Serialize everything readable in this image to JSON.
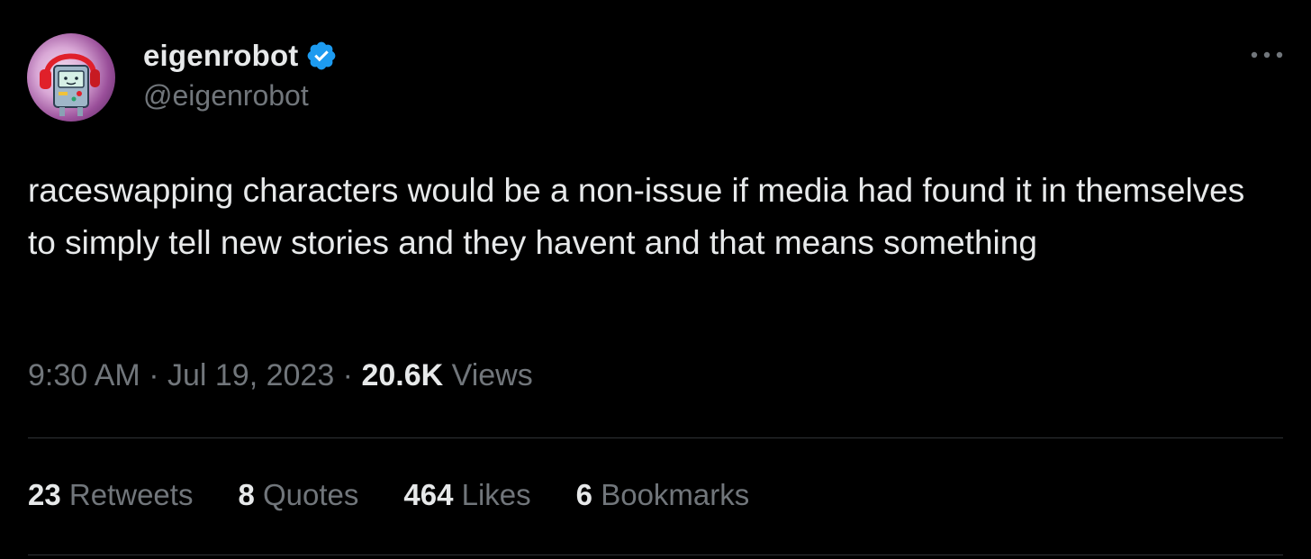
{
  "author": {
    "display_name": "eigenrobot",
    "handle": "@eigenrobot",
    "verified_icon": "verified-badge-icon",
    "avatar_icon": "robot-with-headphones-avatar"
  },
  "tweet": {
    "text": "raceswapping characters would be a non-issue if media had found it in themselves to simply tell new stories and they havent and that means something"
  },
  "meta": {
    "time": "9:30 AM",
    "sep1": " · ",
    "date": "Jul 19, 2023",
    "sep2": " · ",
    "views_count": "20.6K",
    "views_label": " Views"
  },
  "stats": [
    {
      "count": "23",
      "label": " Retweets"
    },
    {
      "count": "8",
      "label": " Quotes"
    },
    {
      "count": "464",
      "label": " Likes"
    },
    {
      "count": "6",
      "label": " Bookmarks"
    }
  ],
  "colors": {
    "background": "#000000",
    "primary_text": "#e7e9ea",
    "secondary_text": "#71767b",
    "divider": "#2f3336",
    "verified_blue": "#1d9bf0"
  }
}
